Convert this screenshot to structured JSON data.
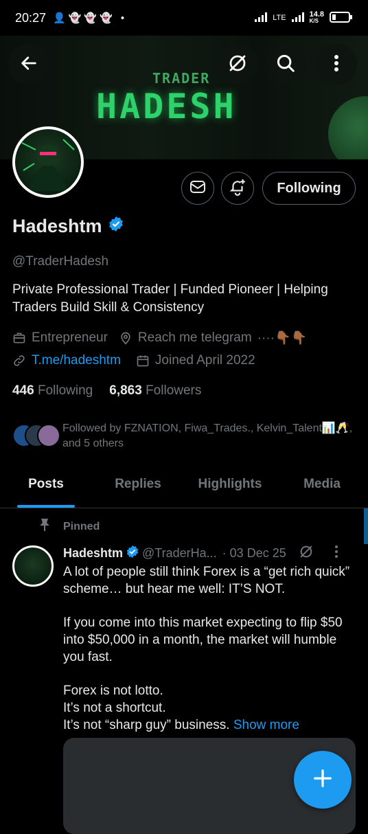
{
  "status_bar": {
    "time": "20:27",
    "network": "LTE",
    "speed_value": "14.8",
    "speed_unit": "K/S"
  },
  "banner": {
    "subtitle": "TRADER",
    "title": "HADESH"
  },
  "profile": {
    "display_name": "Hadeshtm",
    "handle": "@TraderHadesh",
    "bio": "Private Professional Trader | Funded Pioneer | Helping Traders Build Skill & Consistency",
    "category": "Entrepreneur",
    "location": "Reach me telegram",
    "location_emoji": "····👇🏾👇🏾",
    "website": "T.me/hadeshtm",
    "joined": "Joined April 2022",
    "following_count": "446",
    "following_label": "Following",
    "followers_count": "6,863",
    "followers_label": "Followers",
    "follow_button": "Following",
    "followed_by": "Followed by FZNATION, Fiwa_Trades., Kelvin_Talent📊🥂, and 5 others"
  },
  "tabs": [
    {
      "label": "Posts"
    },
    {
      "label": "Replies"
    },
    {
      "label": "Highlights"
    },
    {
      "label": "Media"
    }
  ],
  "post": {
    "pinned_label": "Pinned",
    "author": "Hadeshtm",
    "handle": "@TraderHa...",
    "date": "· 03 Dec 25",
    "para1": "A lot of people still think Forex is a “get rich quick” scheme… but hear me well: IT’S NOT.",
    "para2": "If you come into this market expecting to flip $50 into $50,000 in a month, the market will humble you fast.",
    "line1": "Forex is not lotto.",
    "line2": "It’s not a shortcut.",
    "line3": "It’s not “sharp guy” business.",
    "show_more": "Show more"
  },
  "colors": {
    "accent": "#1d9bf0",
    "muted": "#71767b",
    "text": "#e7e9ea",
    "banner_green": "#2fd16a"
  }
}
